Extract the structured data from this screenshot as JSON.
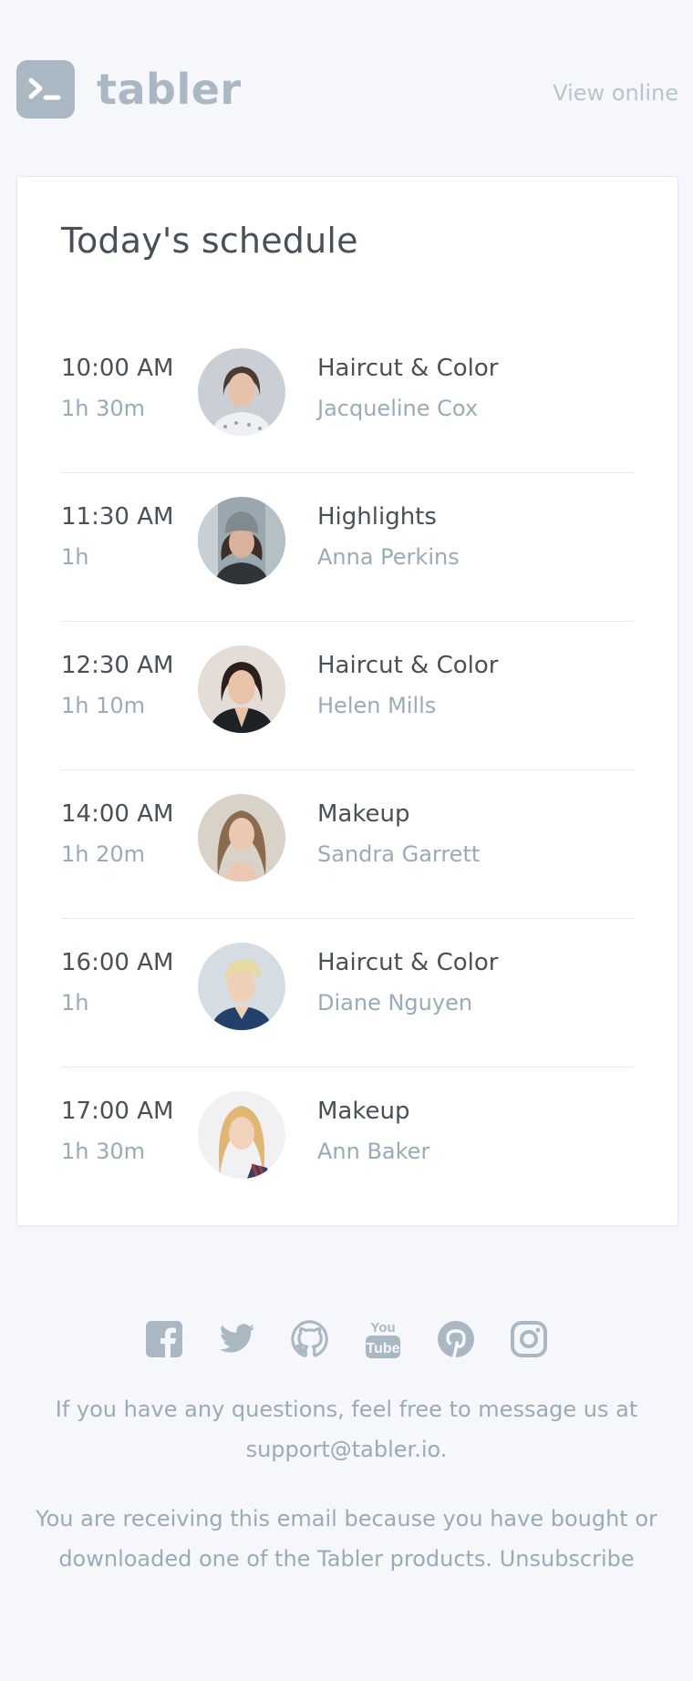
{
  "header": {
    "brand": "tabler",
    "view_online": "View online",
    "logo_icon": "terminal-prompt-icon",
    "brand_color": "#a9b8c2"
  },
  "card": {
    "title": "Today's schedule"
  },
  "schedule": [
    {
      "time": "10:00 AM",
      "duration": "1h 30m",
      "service": "Haircut & Color",
      "client": "Jacqueline Cox"
    },
    {
      "time": "11:30 AM",
      "duration": "1h",
      "service": "Highlights",
      "client": "Anna Perkins"
    },
    {
      "time": "12:30 AM",
      "duration": "1h 10m",
      "service": "Haircut & Color",
      "client": "Helen Mills"
    },
    {
      "time": "14:00 AM",
      "duration": "1h 20m",
      "service": "Makeup",
      "client": "Sandra Garrett"
    },
    {
      "time": "16:00 AM",
      "duration": "1h",
      "service": "Haircut & Color",
      "client": "Diane Nguyen"
    },
    {
      "time": "17:00 AM",
      "duration": "1h 30m",
      "service": "Makeup",
      "client": "Ann Baker"
    }
  ],
  "footer": {
    "socials": [
      "facebook-icon",
      "twitter-icon",
      "github-icon",
      "youtube-icon",
      "pinterest-icon",
      "instagram-icon"
    ],
    "questions_text": "If you have any questions, feel free to message us at",
    "email": "support@tabler.io",
    "email_suffix": ".",
    "receiving_text": "You are receiving this email because you have bought or downloaded one of the Tabler products.",
    "unsubscribe": "Unsubscribe"
  },
  "colors": {
    "background": "#f5f7fb",
    "text": "#495057",
    "muted": "#9aabb8",
    "icon": "#a9b8c2"
  }
}
